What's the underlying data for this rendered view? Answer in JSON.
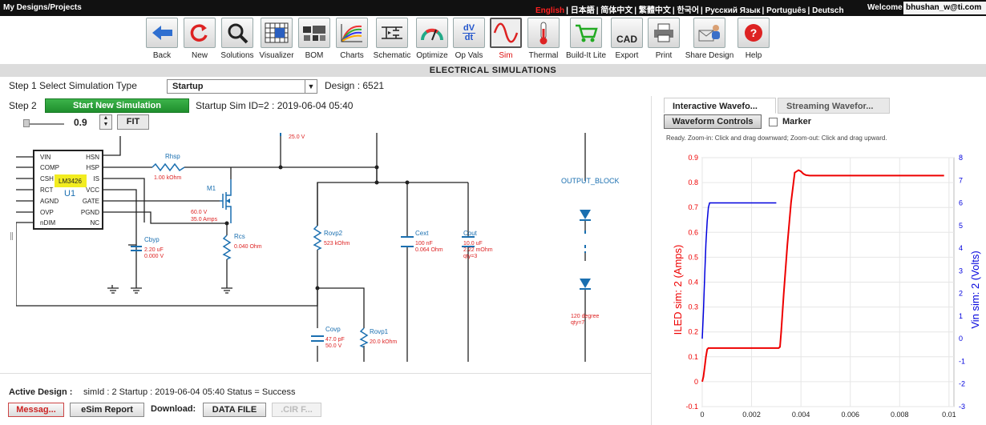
{
  "topbar": {
    "breadcrumb": "My Designs/Projects",
    "languages": [
      "English",
      "日本語",
      "简体中文",
      "繁體中文",
      "한국어",
      "Русский Язык",
      "Português",
      "Deutsch"
    ],
    "welcome": "Welcome",
    "user": "bhushan_w@ti.com"
  },
  "toolbar": {
    "items": [
      {
        "label": "Back",
        "icon": "back-arrow-icon"
      },
      {
        "label": "New",
        "icon": "refresh-icon"
      },
      {
        "label": "Solutions",
        "icon": "magnifier-icon"
      },
      {
        "label": "Visualizer",
        "icon": "grid-icon"
      },
      {
        "label": "BOM",
        "icon": "components-icon"
      },
      {
        "label": "Charts",
        "icon": "chart-icon"
      },
      {
        "label": "Schematic",
        "icon": "schematic-icon"
      },
      {
        "label": "Optimize",
        "icon": "gauge-icon"
      },
      {
        "label": "Op Vals",
        "icon": "dvdt-icon",
        "icon_text_top": "dV",
        "icon_text_bottom": "dt"
      },
      {
        "label": "Sim",
        "icon": "sine-wave-icon"
      },
      {
        "label": "Thermal",
        "icon": "thermometer-icon"
      },
      {
        "label": "Build-It Lite",
        "icon": "cart-icon"
      },
      {
        "label": "Export",
        "icon": "cad-icon",
        "icon_text": "CAD"
      },
      {
        "label": "Print",
        "icon": "printer-icon"
      },
      {
        "label": "Share Design",
        "icon": "share-icon"
      },
      {
        "label": "Help",
        "icon": "help-icon"
      }
    ],
    "selected": "Sim"
  },
  "header": {
    "title": "ELECTRICAL SIMULATIONS"
  },
  "steps": {
    "step1_label": "Step 1  Select Simulation Type",
    "sim_type": "Startup",
    "design": "Design : 6521",
    "step2_label": "Step 2",
    "start_button": "Start New Simulation",
    "sim_info": "Startup Sim ID=2 : 2019-06-04 05:40"
  },
  "zoom": {
    "value": "0.9",
    "fit_label": "FIT"
  },
  "schematic": {
    "ic": {
      "pins_left": [
        "VIN",
        "COMP",
        "CSH",
        "RCT",
        "AGND",
        "OVP",
        "nDIM"
      ],
      "pins_right": [
        "HSN",
        "HSP",
        "IS",
        "VCC",
        "GATE",
        "PGND",
        "NC"
      ],
      "part": "LM3426",
      "ref": "U1"
    },
    "top_value": "25.0 V",
    "rhsp": {
      "name": "Rhsp",
      "value": "1.00 kOhm"
    },
    "m1": {
      "name": "M1",
      "v": "60.0 V",
      "i": "35.0 Amps"
    },
    "rcs": {
      "name": "Rcs",
      "value": "0.040 Ohm"
    },
    "cbyp": {
      "name": "Cbyp",
      "c": "2.20 uF",
      "v": "0.000 V"
    },
    "rovp2": {
      "name": "Rovp2",
      "value": "523 kOhm"
    },
    "cext": {
      "name": "Cext",
      "c": "100 nF",
      "esr": "0.064 Ohm"
    },
    "cout": {
      "name": "Cout",
      "c": "10.0 uF",
      "esr": "2.22 mOhm",
      "qty": "qty=3"
    },
    "covp": {
      "name": "Covp",
      "c": "47.0 pF",
      "v": "50.0 V"
    },
    "rovp1": {
      "name": "Rovp1",
      "value": "20.0 kOhm"
    },
    "output_block": "OUTPUT_BLOCK",
    "led": {
      "deg": "120 degree",
      "qty": "qty=7"
    }
  },
  "bottom": {
    "active_design_label": "Active Design :",
    "status": "simId : 2 Startup : 2019-06-04 05:40 Status = Success",
    "messages_btn": "Messag...",
    "esim_btn": "eSim Report",
    "download_label": "Download:",
    "datafile_btn": "DATA FILE",
    "cir_btn": ".CIR F..."
  },
  "waveform": {
    "tab1": "Interactive Wavefo...",
    "tab2": "Streaming Wavefor...",
    "controls_btn": "Waveform Controls",
    "marker_label": "Marker",
    "help_text": "Ready.  Zoom-in: Click and drag downward; Zoom-out: Click and drag upward."
  },
  "chart_data": {
    "type": "line",
    "title": "",
    "xlabel": "",
    "ylabel_left": "ILED sim:  2 (Amps)",
    "ylabel_right": "Vin sim:  2 (Volts)",
    "xlim": [
      0,
      0.0102
    ],
    "xticks": [
      "0",
      "0.002",
      "0.004",
      "0.006",
      "0.008",
      "0.01"
    ],
    "ylim_left": [
      -0.1,
      0.9
    ],
    "yticks_left": [
      "-0.1",
      "0",
      "0.1",
      "0.2",
      "0.3",
      "0.4",
      "0.5",
      "0.6",
      "0.7",
      "0.8",
      "0.9"
    ],
    "ylim_right": [
      -3,
      8
    ],
    "yticks_right": [
      "-3",
      "-2",
      "-1",
      "0",
      "1",
      "2",
      "3",
      "4",
      "5",
      "6",
      "7",
      "8"
    ],
    "colors": {
      "left": "#ee0000",
      "right": "#0000dd"
    },
    "series": [
      {
        "name": "ILED sim:  2 (Amps)",
        "axis": "left",
        "x": [
          0,
          5e-05,
          0.0001,
          0.00015,
          0.0002,
          0.00025,
          0.0003,
          0.0031,
          0.00315,
          0.0032,
          0.0033,
          0.00345,
          0.0036,
          0.00375,
          0.0039,
          0.004,
          0.0041,
          0.0042,
          0.00435,
          0.0045,
          0.005,
          0.006,
          0.008,
          0.0098
        ],
        "y": [
          0,
          0.02,
          0.06,
          0.1,
          0.13,
          0.135,
          0.135,
          0.135,
          0.14,
          0.2,
          0.35,
          0.55,
          0.72,
          0.84,
          0.85,
          0.845,
          0.835,
          0.83,
          0.828,
          0.828,
          0.828,
          0.828,
          0.828,
          0.828
        ]
      },
      {
        "name": "Vin sim:  2 (Volts)",
        "axis": "right",
        "x": [
          0,
          5e-05,
          0.0001,
          0.00015,
          0.0002,
          0.00025,
          0.0003,
          0.0004,
          0.0005,
          0.003
        ],
        "y": [
          0,
          1.2,
          2.8,
          4.2,
          5.2,
          5.8,
          6.0,
          6.0,
          6.0,
          6.0
        ]
      }
    ]
  }
}
